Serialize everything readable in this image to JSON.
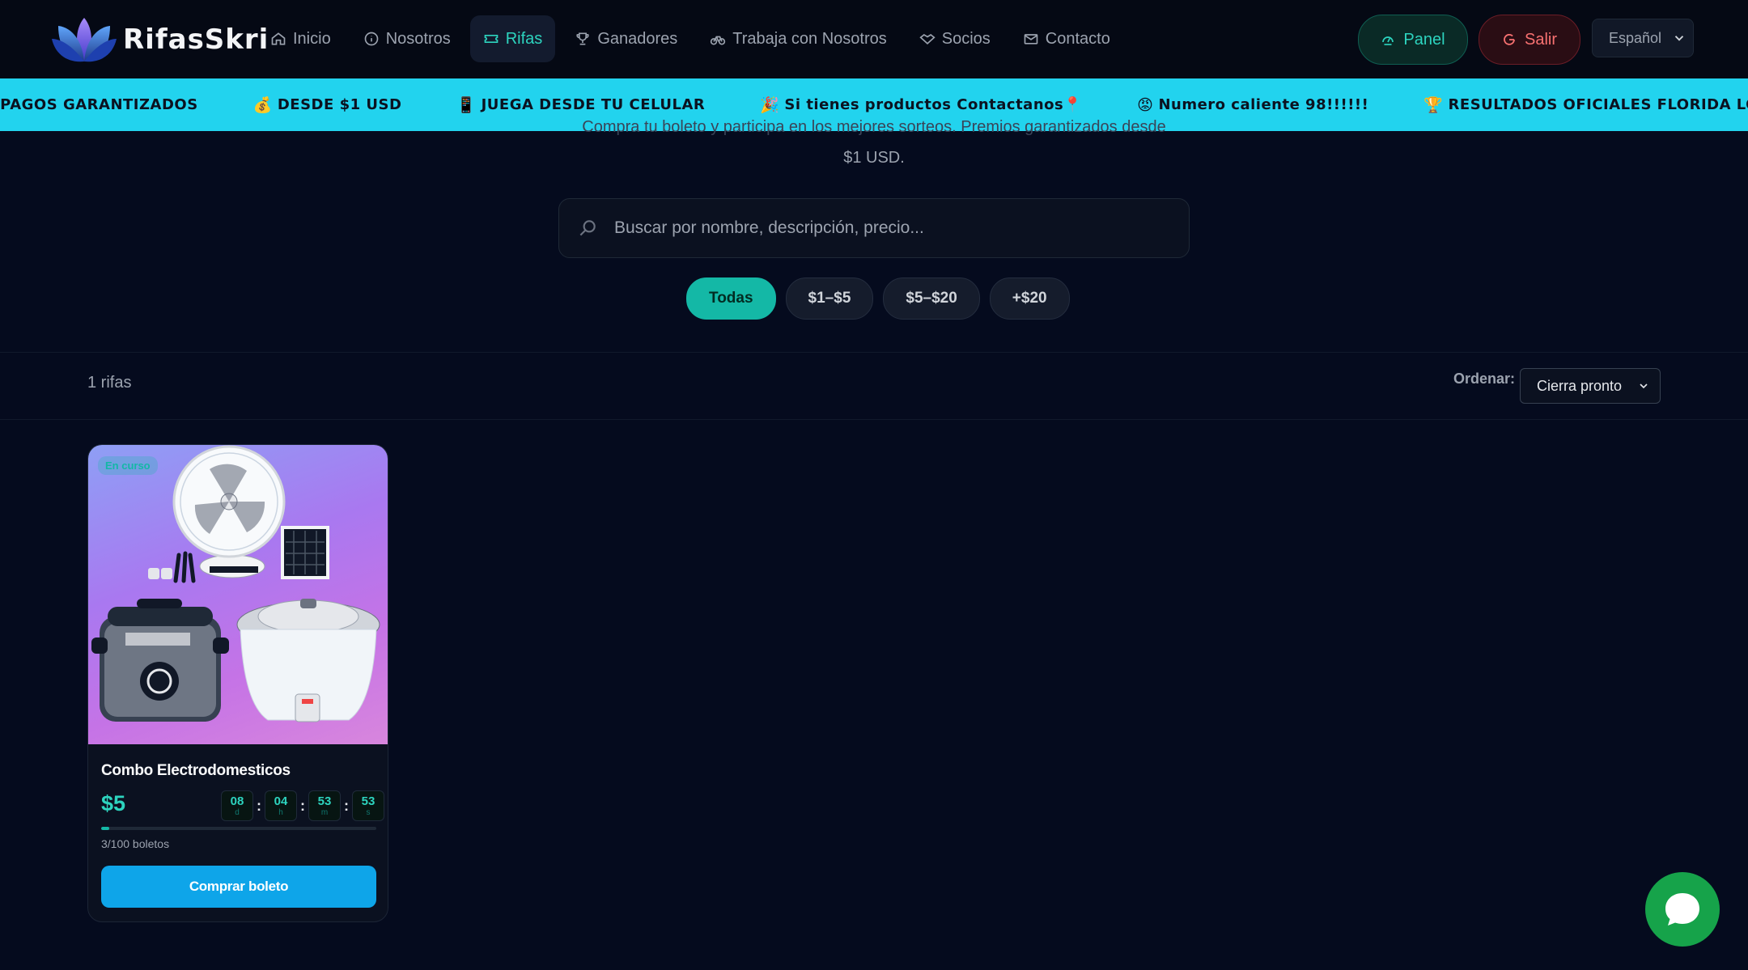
{
  "brand": {
    "name": "RifasSkri"
  },
  "nav": {
    "items": [
      {
        "label": "Inicio",
        "icon": "home-icon"
      },
      {
        "label": "Nosotros",
        "icon": "info-icon"
      },
      {
        "label": "Rifas",
        "icon": "ticket-icon",
        "active": true
      },
      {
        "label": "Ganadores",
        "icon": "trophy-icon"
      },
      {
        "label": "Trabaja con Nosotros",
        "icon": "bike-icon"
      },
      {
        "label": "Socios",
        "icon": "handshake-icon"
      },
      {
        "label": "Contacto",
        "icon": "mail-icon"
      }
    ],
    "panel_label": "Panel",
    "logout_label": "Salir",
    "language": "Español"
  },
  "ticker": {
    "items": [
      {
        "emoji": "💰",
        "text": "DESDE $1 USD"
      },
      {
        "emoji": "📱",
        "text": "JUEGA DESDE TU CELULAR"
      },
      {
        "emoji": "🎉",
        "text": "Si tienes productos Contactanos📍"
      },
      {
        "emoji": "😡",
        "text": "Numero caliente 98!!!!!!"
      },
      {
        "emoji": "🏆",
        "text": "RESULTADOS OFICIALES FLORIDA LOTTERY"
      },
      {
        "emoji": "✅",
        "text": "PAGOS GARANTIZADOS"
      }
    ]
  },
  "hero": {
    "subtitle_line1": "Compra tu boleto y participa en los mejores sorteos. Premios garantizados desde",
    "subtitle_line2": "$1 USD."
  },
  "search": {
    "placeholder": "Buscar por nombre, descripción, precio..."
  },
  "filters": [
    {
      "label": "Todas",
      "active": true
    },
    {
      "label": "$1–$5"
    },
    {
      "label": "$5–$20"
    },
    {
      "label": "+$20"
    }
  ],
  "results": {
    "count_label": "1 rifas",
    "sort_label": "Ordenar:",
    "sort_value": "Cierra pronto"
  },
  "raffles": [
    {
      "status": "En curso",
      "title": "Combo Electrodomesticos",
      "price": "$5",
      "countdown": [
        {
          "value": "08",
          "unit": "d"
        },
        {
          "value": "04",
          "unit": "h"
        },
        {
          "value": "53",
          "unit": "m"
        },
        {
          "value": "53",
          "unit": "s"
        }
      ],
      "sold": 3,
      "total": 100,
      "progress_fraction": 0.03,
      "sold_label": "3/100 boletos",
      "button_label": "Comprar boleto"
    }
  ],
  "colors": {
    "background": "#050b1e",
    "accent": "#14b8a6",
    "ticker": "#22d3ee",
    "buy_button": "#0ea5e9",
    "chat": "#16a34a"
  }
}
